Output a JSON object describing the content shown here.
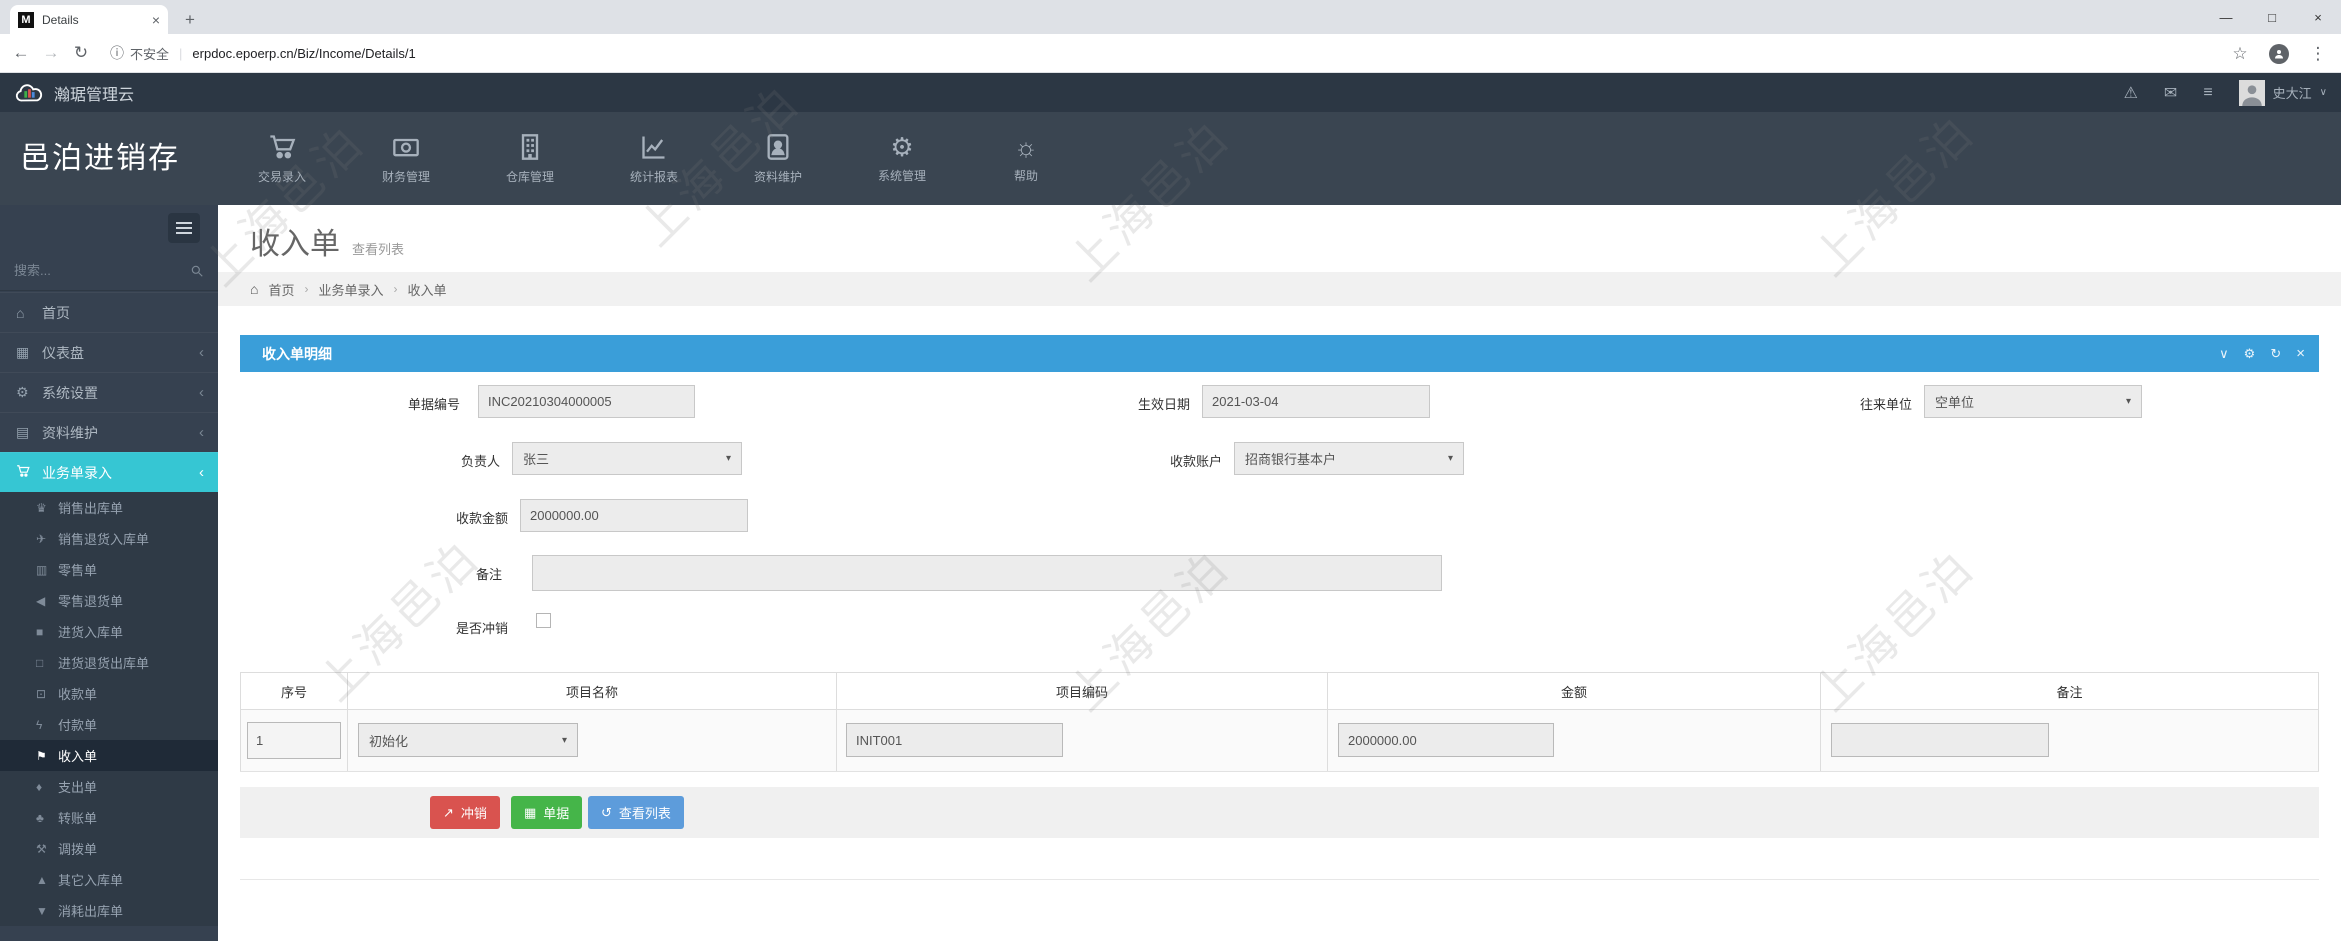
{
  "browser": {
    "tab_title": "Details",
    "favicon_letter": "M",
    "security_label": "不安全",
    "url": "erpdoc.epoerp.cn/Biz/Income/Details/1"
  },
  "icons": {
    "plus": "+",
    "close": "×",
    "minimize": "—",
    "maximize": "□",
    "back": "←",
    "forward": "→",
    "reload": "↻",
    "info": "ⓘ",
    "star": "☆",
    "dots": "⋮",
    "warning": "⚠",
    "mail": "✉",
    "list": "≡",
    "chevron_down": "∨",
    "chevron_left": "‹",
    "home": "⌂",
    "dashboard": "▦",
    "gear": "⚙",
    "book": "▤",
    "sun": "☼",
    "trophy": "♛",
    "send": "✈",
    "barcode": "▥",
    "horn": "◀",
    "bookmark": "■",
    "bookmark_o": "□",
    "money": "⊡",
    "bolt": "ϟ",
    "flag": "⚑",
    "drop": "♦",
    "leaf": "♣",
    "gavel": "⚒",
    "tri_up": "▲",
    "tri_down": "▼",
    "wrench": "⚙",
    "refresh": "↻",
    "panel_close": "×",
    "btn_external": "↗",
    "btn_table": "▦",
    "btn_undo": "↺",
    "select_arrow": "▾",
    "breadcrumb_sep": "›"
  },
  "header": {
    "brand": "瀚琚管理云",
    "user": "史大江"
  },
  "sidebar": {
    "brand": "邑泊进销存",
    "search_placeholder": "搜索...",
    "menu": [
      {
        "label": "首页"
      },
      {
        "label": "仪表盘"
      },
      {
        "label": "系统设置"
      },
      {
        "label": "资料维护"
      },
      {
        "label": "业务单录入"
      }
    ],
    "submenu": [
      {
        "label": "销售出库单"
      },
      {
        "label": "销售退货入库单"
      },
      {
        "label": "零售单"
      },
      {
        "label": "零售退货单"
      },
      {
        "label": "进货入库单"
      },
      {
        "label": "进货退货出库单"
      },
      {
        "label": "收款单"
      },
      {
        "label": "付款单"
      },
      {
        "label": "收入单"
      },
      {
        "label": "支出单"
      },
      {
        "label": "转账单"
      },
      {
        "label": "调拨单"
      },
      {
        "label": "其它入库单"
      },
      {
        "label": "消耗出库单"
      }
    ]
  },
  "topnav": {
    "items": [
      {
        "label": "交易录入",
        "icon": "cart-icon"
      },
      {
        "label": "财务管理",
        "icon": "banknote-icon"
      },
      {
        "label": "仓库管理",
        "icon": "building-icon"
      },
      {
        "label": "统计报表",
        "icon": "chart-icon"
      },
      {
        "label": "资料维护",
        "icon": "address-book-icon"
      },
      {
        "label": "系统管理",
        "icon": "gears-icon"
      },
      {
        "label": "帮助",
        "icon": "sun-icon"
      }
    ]
  },
  "page": {
    "title": "收入单",
    "subtitle": "查看列表",
    "breadcrumb": [
      {
        "label": "首页"
      },
      {
        "label": "业务单录入"
      },
      {
        "label": "收入单"
      }
    ]
  },
  "panel": {
    "title": "收入单明细",
    "form": {
      "doc_no": {
        "label": "单据编号",
        "value": "INC20210304000005"
      },
      "date": {
        "label": "生效日期",
        "value": "2021-03-04"
      },
      "partner": {
        "label": "往来单位",
        "value": "空单位"
      },
      "manager": {
        "label": "负责人",
        "value": "张三"
      },
      "account": {
        "label": "收款账户",
        "value": "招商银行基本户"
      },
      "amount": {
        "label": "收款金额",
        "value": "2000000.00"
      },
      "remark": {
        "label": "备注",
        "value": ""
      },
      "writeoff": {
        "label": "是否冲销",
        "checked": false
      }
    },
    "table": {
      "headers": [
        "序号",
        "项目名称",
        "项目编码",
        "金额",
        "备注"
      ],
      "row": {
        "no": "1",
        "project": "初始化",
        "code": "INIT001",
        "amount": "2000000.00",
        "remark": ""
      }
    },
    "buttons": [
      {
        "label": "冲销",
        "color": "#d9534f"
      },
      {
        "label": "单据",
        "color": "#45b549"
      },
      {
        "label": "查看列表",
        "color": "#5d9cdb"
      }
    ]
  },
  "watermark": {
    "text": "上海邑泊"
  }
}
